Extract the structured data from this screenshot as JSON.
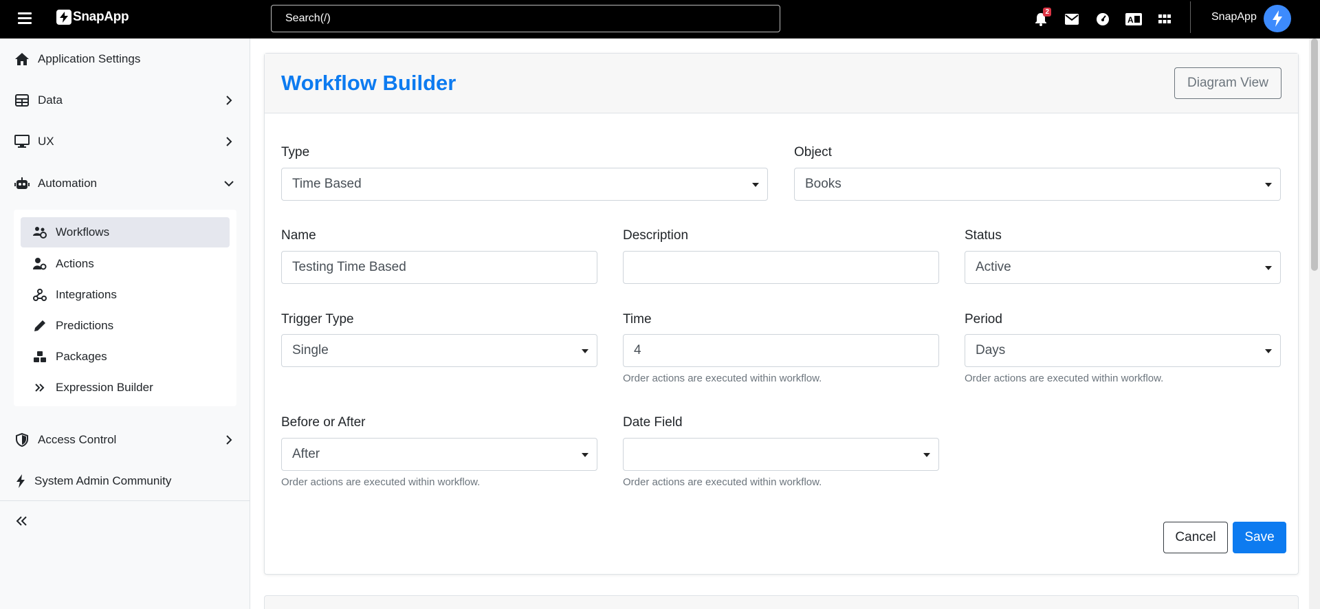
{
  "topbar": {
    "brand": "SnapApp",
    "search_placeholder": "Search(/)",
    "notification_count": "2",
    "user_name": "SnapApp",
    "icons": [
      "menu-icon",
      "bell-icon",
      "envelope-icon",
      "dashboard-icon",
      "language-icon",
      "apps-grid-icon",
      "bolt-icon"
    ]
  },
  "sidebar": {
    "items": [
      {
        "label": "Application Settings",
        "icon": "home-icon"
      },
      {
        "label": "Data",
        "icon": "table-icon"
      },
      {
        "label": "UX",
        "icon": "monitor-icon"
      },
      {
        "label": "Automation",
        "icon": "robot-icon"
      },
      {
        "label": "Access Control",
        "icon": "shield-icon"
      },
      {
        "label": "System Admin Community",
        "icon": "bolt-icon"
      }
    ],
    "sub_items": [
      {
        "label": "Workflows",
        "icon": "users-cog-icon",
        "active": true
      },
      {
        "label": "Actions",
        "icon": "user-cog-icon"
      },
      {
        "label": "Integrations",
        "icon": "integration-icon"
      },
      {
        "label": "Predictions",
        "icon": "pencil-icon"
      },
      {
        "label": "Packages",
        "icon": "cubes-icon"
      },
      {
        "label": "Expression Builder",
        "icon": "double-chevron-icon"
      }
    ]
  },
  "main": {
    "title": "Workflow Builder",
    "diagram_view_label": "Diagram View",
    "fields": {
      "type": {
        "label": "Type",
        "value": "Time Based"
      },
      "object": {
        "label": "Object",
        "value": "Books"
      },
      "name": {
        "label": "Name",
        "value": "Testing Time Based"
      },
      "description": {
        "label": "Description",
        "value": ""
      },
      "status": {
        "label": "Status",
        "value": "Active"
      },
      "trigger_type": {
        "label": "Trigger Type",
        "value": "Single"
      },
      "time": {
        "label": "Time",
        "value": "4",
        "hint": "Order actions are executed within workflow."
      },
      "period": {
        "label": "Period",
        "value": "Days",
        "hint": "Order actions are executed within workflow."
      },
      "before_after": {
        "label": "Before or After",
        "value": "After",
        "hint": "Order actions are executed within workflow."
      },
      "date_field": {
        "label": "Date Field",
        "value": "",
        "hint": "Order actions are executed within workflow."
      }
    },
    "cancel_label": "Cancel",
    "save_label": "Save"
  },
  "colors": {
    "accent": "#0d7bf0",
    "topbar_bg": "#000000",
    "sidebar_bg": "#f8f9fa",
    "active_item_bg": "#e5e7ee",
    "badge": "#dc3545"
  }
}
